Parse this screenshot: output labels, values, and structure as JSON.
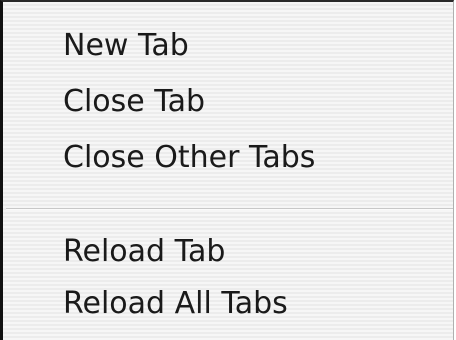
{
  "context_menu": {
    "group_1": [
      {
        "label": "New Tab"
      },
      {
        "label": "Close Tab"
      },
      {
        "label": "Close Other Tabs"
      }
    ],
    "group_2": [
      {
        "label": "Reload Tab"
      },
      {
        "label": "Reload All Tabs"
      }
    ]
  }
}
